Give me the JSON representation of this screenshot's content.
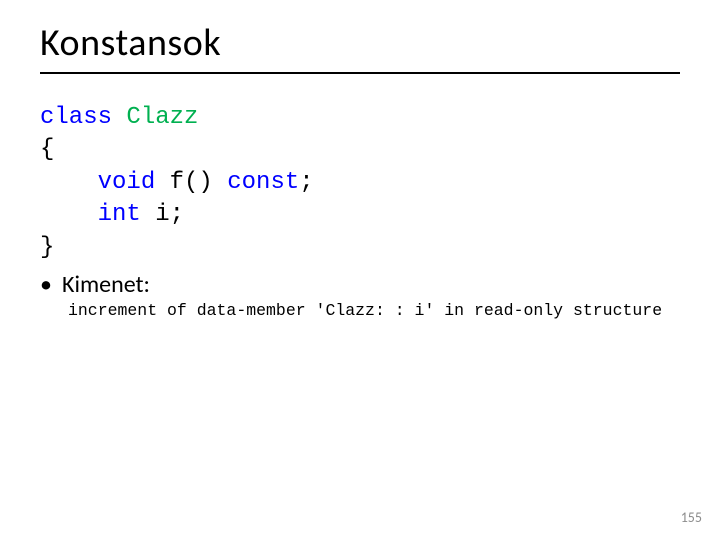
{
  "title": "Konstansok",
  "code": {
    "kw_class": "class",
    "classname": " Clazz",
    "open_brace": "{",
    "line_void_kw": "void",
    "line_void_rest": " f() ",
    "line_void_const": "const",
    "line_void_semi": ";",
    "line_int_kw": "int",
    "line_int_rest": " i;",
    "close_brace": "}"
  },
  "bullet_label": "Kimenet:",
  "output_line": "increment of data-member 'Clazz: : i' in read-only structure",
  "page_number": "155"
}
